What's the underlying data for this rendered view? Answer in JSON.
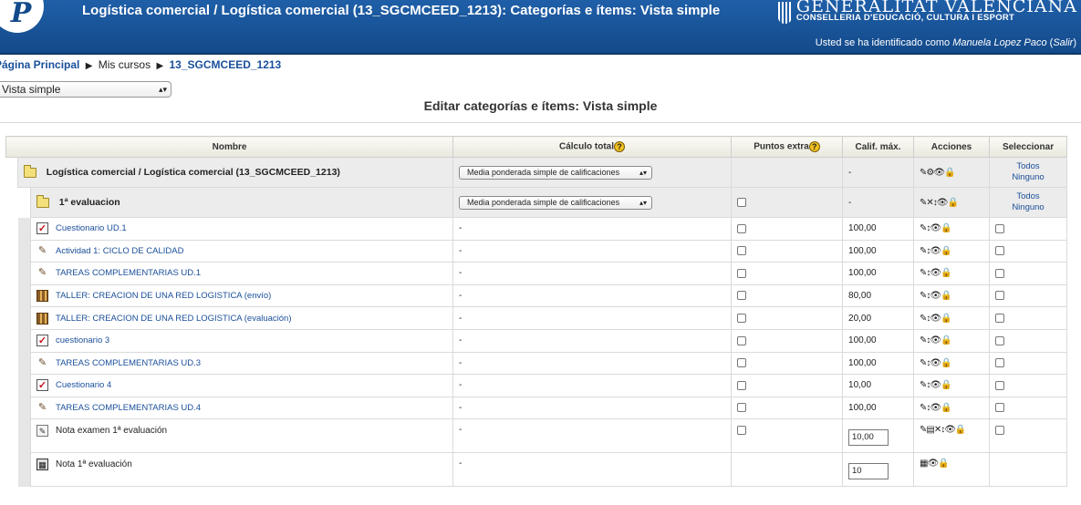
{
  "header": {
    "title": "Logística comercial / Logística comercial (13_SGCMCEED_1213): Categorías e ítems: Vista simple",
    "logo_letter": "P",
    "brand_big": "GENERALITAT VALENCIANA",
    "brand_small": "CONSELLERIA D'EDUCACIÓ, CULTURA I ESPORT",
    "login_prefix": "Usted se ha identificado como",
    "login_user": "Manuela Lopez Paco",
    "logout_label": "Salir"
  },
  "breadcrumb": {
    "home": "Página Principal",
    "my_courses": "Mis cursos",
    "course": "13_SGCMCEED_1213"
  },
  "view_select": {
    "value": "Vista simple"
  },
  "page_heading": "Editar categorías e ítems: Vista simple",
  "columns": {
    "name": "Nombre",
    "calc": "Cálculo total",
    "extra": "Puntos extra",
    "max": "Calif. máx.",
    "actions": "Acciones",
    "select": "Seleccionar"
  },
  "categories": [
    {
      "name": "Logística comercial / Logística comercial (13_SGCMCEED_1213)",
      "calc": "Media ponderada simple de calificaciones",
      "max": "-",
      "actions": "✎⚙👁🔒",
      "all": "Todos",
      "none": "Ninguno"
    },
    {
      "name": "1ª evaluacion",
      "calc": "Media ponderada simple de calificaciones",
      "max": "-",
      "actions": "✎✕↕👁🔒",
      "all": "Todos",
      "none": "Ninguno"
    }
  ],
  "items": [
    {
      "name": "Cuestionario UD.1",
      "icon": "quiz-icon",
      "calc": "-",
      "max": "100,00",
      "actions": "✎↕👁🔒"
    },
    {
      "name": "Actividad 1: CICLO DE CALIDAD",
      "icon": "assignment-icon",
      "calc": "-",
      "max": "100,00",
      "actions": "✎↕👁🔒"
    },
    {
      "name": "TAREAS COMPLEMENTARIAS UD.1",
      "icon": "assignment-icon",
      "calc": "-",
      "max": "100,00",
      "actions": "✎↕👁🔒"
    },
    {
      "name": "TALLER: CREACION DE UNA RED LOGISTICA (envío)",
      "icon": "workshop-icon",
      "calc": "-",
      "max": "80,00",
      "actions": "✎↕👁🔒"
    },
    {
      "name": "TALLER: CREACION DE UNA RED LOGISTICA (evaluación)",
      "icon": "workshop-icon",
      "calc": "-",
      "max": "20,00",
      "actions": "✎↕👁🔒"
    },
    {
      "name": "cuestionario 3",
      "icon": "quiz-icon",
      "calc": "-",
      "max": "100,00",
      "actions": "✎↕👁🔒"
    },
    {
      "name": "TAREAS COMPLEMENTARIAS UD.3",
      "icon": "assignment-icon",
      "calc": "-",
      "max": "100,00",
      "actions": "✎↕👁🔒"
    },
    {
      "name": "Cuestionario 4",
      "icon": "quiz-icon",
      "calc": "-",
      "max": "10,00",
      "actions": "✎↕👁🔒"
    },
    {
      "name": "TAREAS COMPLEMENTARIAS UD.4",
      "icon": "assignment-icon",
      "calc": "-",
      "max": "100,00",
      "actions": "✎↕👁🔒"
    }
  ],
  "manual_item": {
    "name": "Nota examen 1ª evaluación",
    "calc": "-",
    "max_input": "10,00",
    "actions": "✎▤✕↕👁🔒"
  },
  "total_item": {
    "name": "Nota 1ª evaluación",
    "calc": "-",
    "max_input": "10",
    "actions": "▦👁🔒"
  }
}
